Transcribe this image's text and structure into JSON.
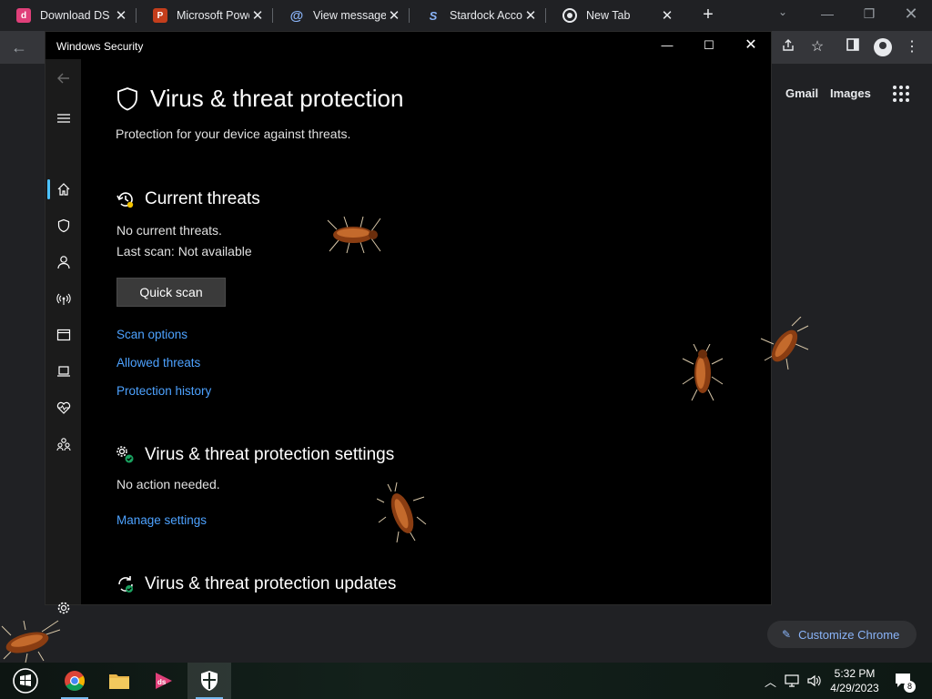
{
  "chrome": {
    "tabs": [
      {
        "title": "Download DS",
        "favicon": "ds-app-icon",
        "color": "#e0407a"
      },
      {
        "title": "Microsoft Powe",
        "favicon": "powerpoint-icon",
        "color": "#c43e1c"
      },
      {
        "title": "View message -",
        "favicon": "at-sign-icon",
        "color": "#8ab4f8"
      },
      {
        "title": "Stardock Accou",
        "favicon": "stardock-icon",
        "color": "#8ab4f8"
      },
      {
        "title": "New Tab",
        "favicon": "chrome-icon",
        "color": "#e8eaed"
      }
    ],
    "new_tab_symbol": "+",
    "ntp": {
      "gmail": "Gmail",
      "images": "Images",
      "customize": "Customize Chrome"
    }
  },
  "security": {
    "window_title": "Windows Security",
    "page_title": "Virus & threat protection",
    "page_subtitle": "Protection for your device against threats.",
    "current_threats": {
      "title": "Current threats",
      "status": "No current threats.",
      "last_scan": "Last scan: Not available",
      "quick_scan": "Quick scan",
      "links": [
        "Scan options",
        "Allowed threats",
        "Protection history"
      ]
    },
    "settings": {
      "title": "Virus & threat protection settings",
      "status": "No action needed.",
      "link": "Manage settings"
    },
    "updates": {
      "title": "Virus & threat protection updates"
    },
    "nav_icons": [
      "back-arrow-icon",
      "hamburger-menu-icon",
      "home-icon",
      "shield-icon",
      "account-icon",
      "firewall-network-icon",
      "app-browser-control-icon",
      "device-security-icon",
      "device-health-icon",
      "family-options-icon",
      "settings-gear-icon"
    ],
    "accent": "#4cc2ff",
    "link_color": "#4da2ff"
  },
  "taskbar": {
    "time": "5:32 PM",
    "date": "4/29/2023",
    "notification_count": "8",
    "apps": [
      "windows-start-icon",
      "chrome-icon",
      "file-explorer-icon",
      "ds-app-icon",
      "windows-security-icon"
    ]
  }
}
